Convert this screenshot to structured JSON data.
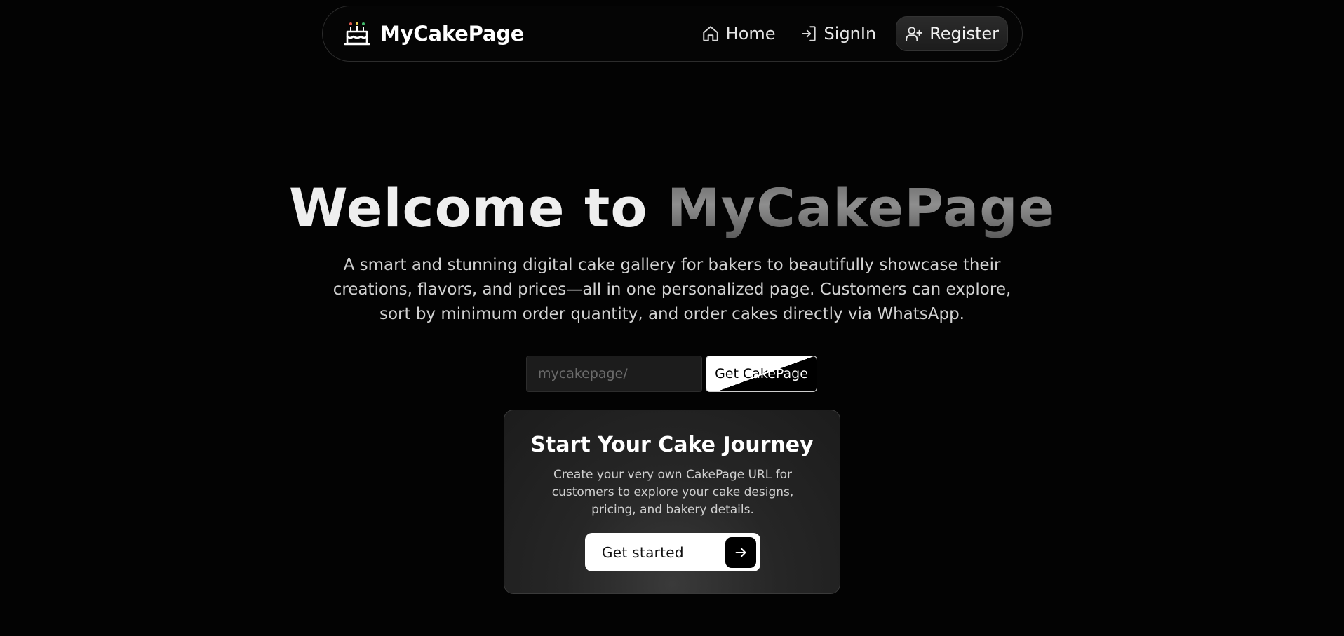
{
  "nav": {
    "brand": "MyCakePage",
    "links": [
      {
        "label": "Home",
        "icon": "home-icon"
      },
      {
        "label": "SignIn",
        "icon": "sign-in-icon"
      },
      {
        "label": "Register",
        "icon": "user-plus-icon"
      }
    ]
  },
  "hero": {
    "title_part1": "Welcome to",
    "title_part2": "MyCakePage",
    "description": "A smart and stunning digital cake gallery for bakers to beautifully showcase their creations, flavors, and prices—all in one personalized page. Customers can explore, sort by minimum order quantity, and order cakes directly via WhatsApp."
  },
  "claim": {
    "placeholder": "mycakepage/",
    "value": "",
    "button_label": "Get CakePage"
  },
  "card": {
    "title": "Start Your Cake Journey",
    "text": "Create your very own CakePage URL for customers to explore your cake designs, pricing, and bakery details.",
    "cta_label": "Get started",
    "cta_icon": "arrow-right-icon"
  },
  "colors": {
    "background": "#030303",
    "text": "#eeeeee",
    "muted_title": "#7a7a7a",
    "card": "#262626",
    "cta": "#ffffff"
  }
}
